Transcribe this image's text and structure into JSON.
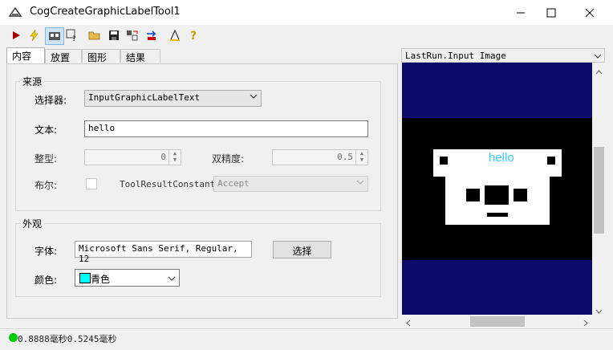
{
  "window": {
    "title": "CogCreateGraphicLabelTool1"
  },
  "toolbar": {
    "icons": [
      "run-icon",
      "lightning-icon",
      "show-image-icon",
      "help-pointer-icon",
      "open-folder-icon",
      "save-icon",
      "reset-icon",
      "local-icon",
      "edit-icon",
      "help-icon"
    ]
  },
  "tabs": [
    "内容",
    "放置",
    "图形",
    "结果"
  ],
  "source": {
    "group_title": "来源",
    "selector_label": "选择器:",
    "selector_value": "InputGraphicLabelText",
    "text_label": "文本:",
    "text_value": "hello",
    "int_label": "整型:",
    "int_value": "0",
    "double_label": "双精度:",
    "double_value": "0.5",
    "bool_label": "布尔:",
    "toolresult_label": "ToolResultConstant:",
    "toolresult_value": "Accept"
  },
  "appearance": {
    "group_title": "外观",
    "font_label": "字体:",
    "font_value": "Microsoft Sans Serif, Regular, 12",
    "choose_button": "选择",
    "color_label": "颜色:",
    "color_value": "青色",
    "color_swatch": "#00ffff"
  },
  "image_panel": {
    "dropdown_value": "LastRun.Input Image",
    "overlay_text": "hello",
    "overlay_color": "#33ccff"
  },
  "status": {
    "indicator_color": "#00cc00",
    "time_text": "0.8888毫秒0.5245毫秒"
  }
}
